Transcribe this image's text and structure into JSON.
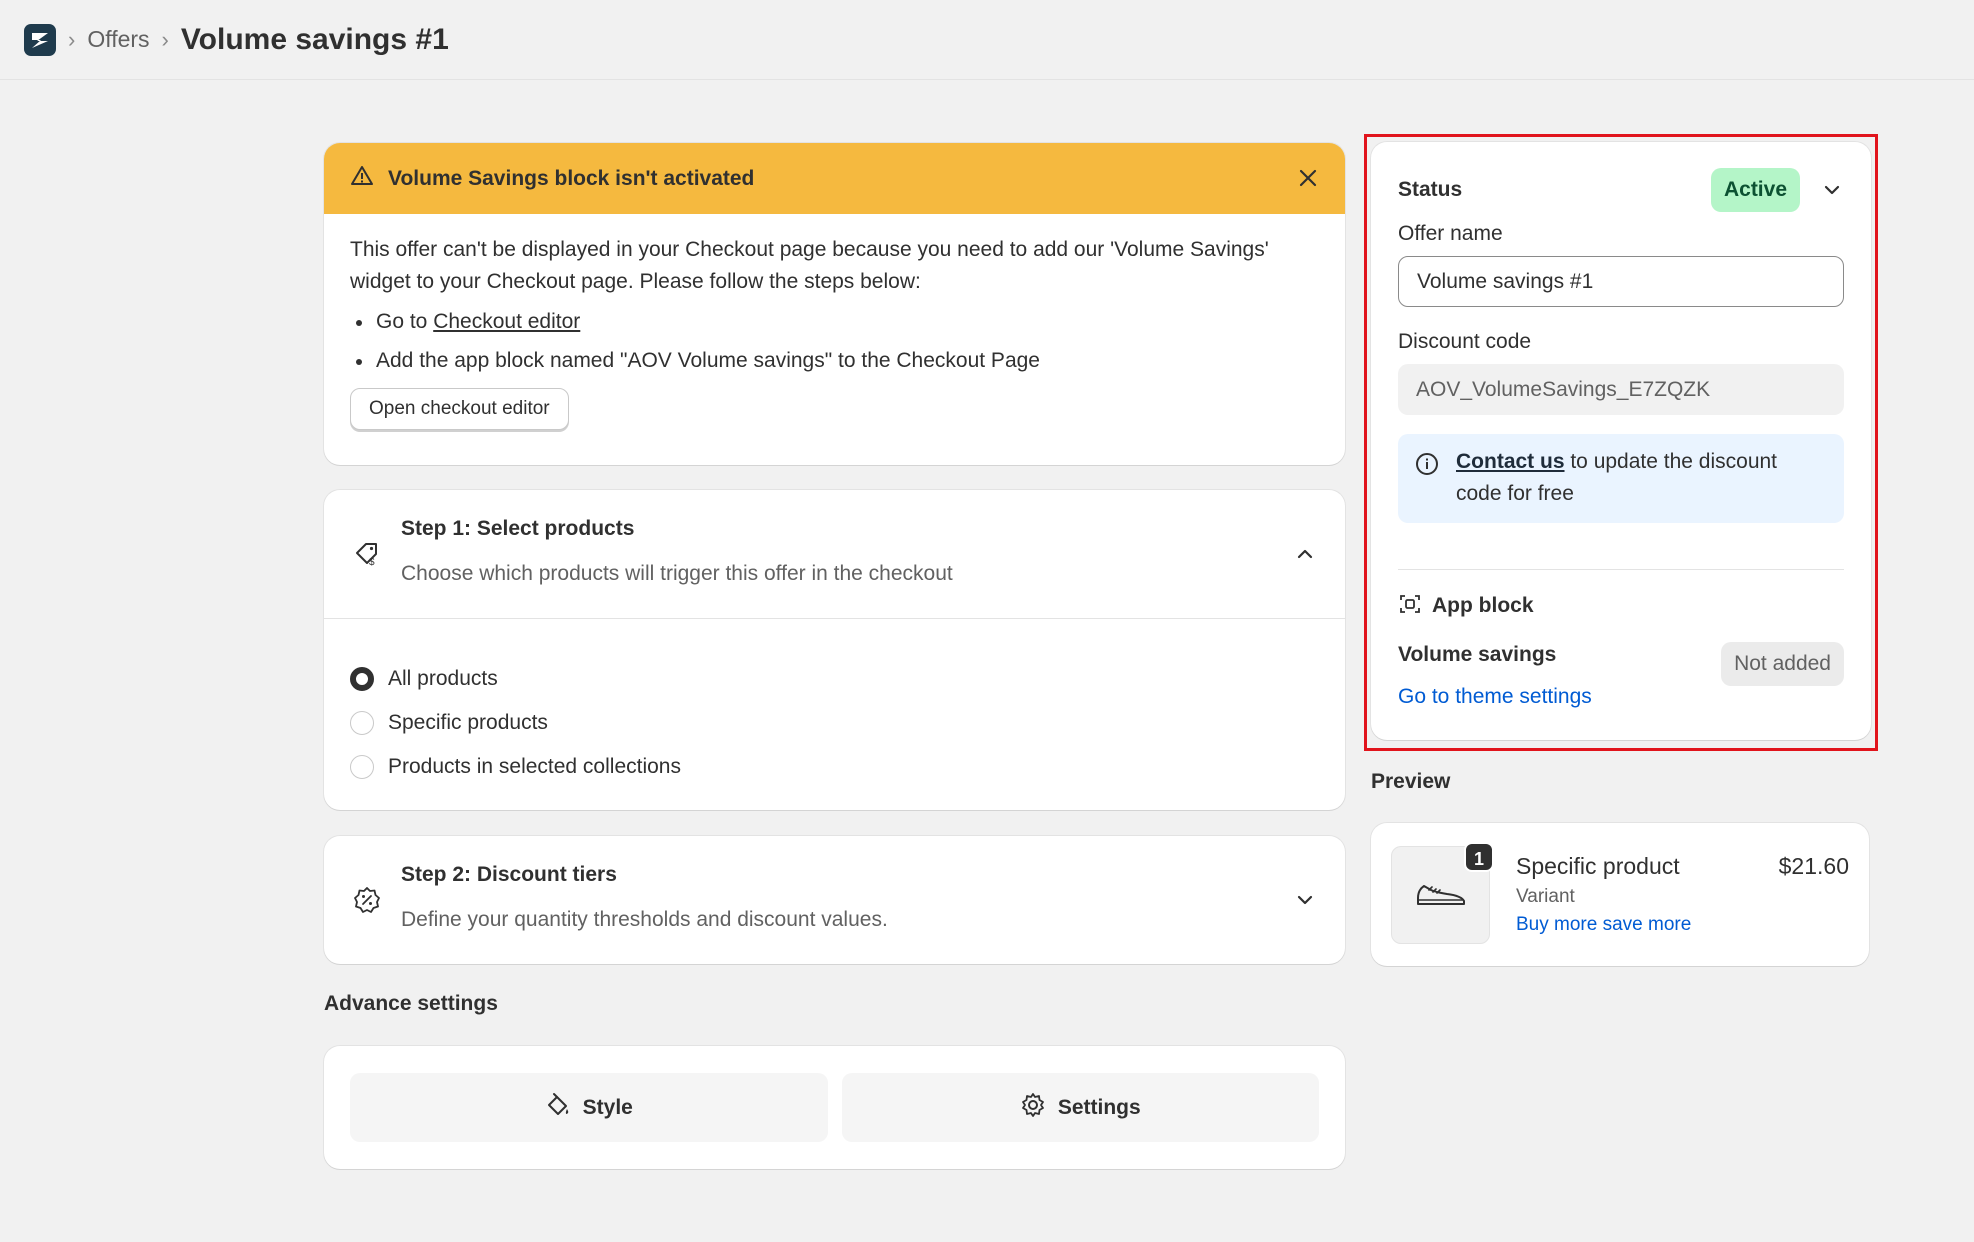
{
  "breadcrumb": {
    "parent": "Offers",
    "separator": "›",
    "title": "Volume savings #1"
  },
  "banner": {
    "title": "Volume Savings block isn't activated",
    "body": "This offer can't be displayed in your Checkout page because you need to add our 'Volume Savings' widget to your Checkout page. Please follow the steps below:",
    "step1_prefix": "Go to ",
    "step1_link": "Checkout editor",
    "step2": "Add the app block named \"AOV Volume savings\" to the Checkout Page",
    "button_label": "Open checkout editor",
    "color": "#f5b93f"
  },
  "step1": {
    "title": "Step 1: Select products",
    "subtitle": "Choose which products will trigger this offer in the checkout",
    "options": [
      {
        "label": "All products",
        "selected": true
      },
      {
        "label": "Specific products",
        "selected": false
      },
      {
        "label": "Products in selected collections",
        "selected": false
      }
    ]
  },
  "step2": {
    "title": "Step 2: Discount tiers",
    "subtitle": "Define your quantity thresholds and discount values."
  },
  "advance": {
    "label": "Advance settings",
    "style_label": "Style",
    "settings_label": "Settings"
  },
  "status_panel": {
    "status_label": "Status",
    "status_value": "Active",
    "offer_name_label": "Offer name",
    "offer_name_value": "Volume savings #1",
    "discount_code_label": "Discount code",
    "discount_code_value": "AOV_VolumeSavings_E7ZQZK",
    "info_link": "Contact us",
    "info_text": " to update the discount code for free",
    "app_block_title": "App block",
    "volume_savings_label": "Volume savings",
    "volume_savings_status": "Not added",
    "theme_link": "Go to theme settings",
    "active_color": "#b4f5c8",
    "highlight_color": "#e1141c"
  },
  "preview": {
    "label": "Preview",
    "quantity": "1",
    "product_name": "Specific product",
    "variant": "Variant",
    "price": "$21.60",
    "link": "Buy more save more"
  },
  "icons": {
    "logo": "app-logo-icon",
    "warning": "warning-icon",
    "close": "close-icon",
    "product_tag": "product-tag-icon",
    "discount": "discount-icon",
    "chevron_up": "chevron-up-icon",
    "chevron_down": "chevron-down-icon",
    "paint": "paint-brush-icon",
    "gear": "gear-icon",
    "info": "info-icon",
    "app_block": "app-block-icon",
    "shoe": "shoe-icon"
  }
}
